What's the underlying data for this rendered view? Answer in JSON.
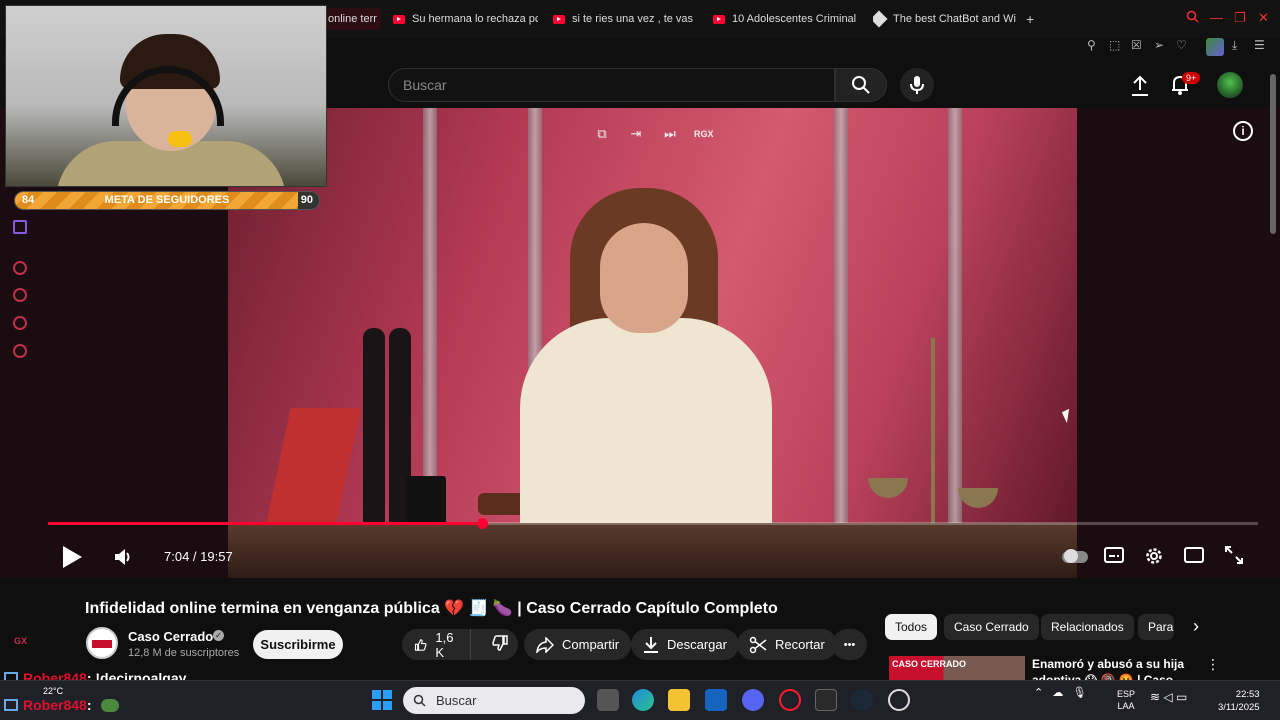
{
  "browser": {
    "tabs": [
      {
        "label": "online terr",
        "active": true
      },
      {
        "label": "Su hermana lo rechaza pc"
      },
      {
        "label": "si te ries una vez , te vas"
      },
      {
        "label": "10 Adolescentes Criminal"
      },
      {
        "label": "The best ChatBot and Wic"
      }
    ],
    "new_tab": "+"
  },
  "youtube": {
    "search_placeholder": "Buscar",
    "notifications_badge": "9+"
  },
  "player": {
    "time": "7:04 / 19:57",
    "progress": 0.359,
    "overlay_badge": "RGX"
  },
  "stream_overlay": {
    "goal_start": "84",
    "goal_label": "META DE SEGUIDORES",
    "goal_end": "90",
    "goal_progress": 0.93,
    "chat": [
      {
        "user": "Rober848",
        "message": ": !decirnoalgay"
      },
      {
        "user": "Rober848",
        "message": ":"
      }
    ],
    "chat_side_badge": "GX"
  },
  "video": {
    "title": "Infidelidad online termina en venganza pública 💔 🧾 🍆 | Caso Cerrado Capítulo Completo",
    "channel": "Caso Cerrado",
    "verified": "✓",
    "subscribers": "12,8 M de suscriptores",
    "subscribe_label": "Suscribirme",
    "likes": "1,6 K",
    "share_label": "Compartir",
    "download_label": "Descargar",
    "clip_label": "Recortar",
    "more_label": "•••"
  },
  "recommendations": {
    "chips": [
      "Todos",
      "Caso Cerrado",
      "Relacionados",
      "Para"
    ],
    "first": {
      "title": "Enamoró y abusó a su hija adoptiva 😱 🔞 🤬 | Caso",
      "thumb_text": "CASO CERRADO"
    }
  },
  "taskbar": {
    "temperature": "22°C",
    "search_label": "Buscar",
    "lang_top": "ESP",
    "lang_bottom": "LAA",
    "time": "22:53",
    "date": "3/11/2025"
  },
  "colors": {
    "accent": "#ff0033",
    "chat_user": "#e0102e",
    "goal_bar": "#f2a636"
  }
}
